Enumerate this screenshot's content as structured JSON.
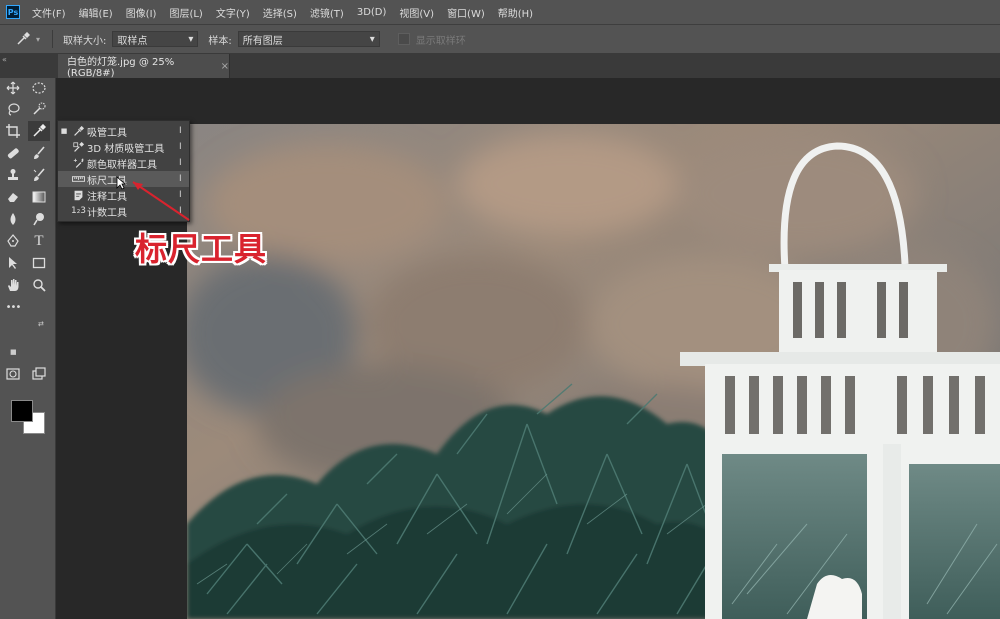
{
  "app": {
    "logo_text": "Ps"
  },
  "menubar": {
    "items": [
      "文件(F)",
      "编辑(E)",
      "图像(I)",
      "图层(L)",
      "文字(Y)",
      "选择(S)",
      "滤镜(T)",
      "3D(D)",
      "视图(V)",
      "窗口(W)",
      "帮助(H)"
    ]
  },
  "options": {
    "tool_icon": "eyedropper-icon",
    "sample_size_label": "取样大小:",
    "sample_size_value": "取样点",
    "sample_label": "样本:",
    "sample_value": "所有图层",
    "show_ring_label": "显示取样环"
  },
  "document": {
    "tab_title": "白色的灯笼.jpg @ 25%(RGB/8#)",
    "close_glyph": "×",
    "panel_collapse": "«"
  },
  "toolbar": {
    "tools": [
      "move-icon",
      "marquee-icon",
      "lasso-icon",
      "quick-select-icon",
      "crop-icon",
      "eyedropper-icon",
      "healing-icon",
      "brush-icon",
      "stamp-icon",
      "history-brush-icon",
      "eraser-icon",
      "gradient-icon",
      "blur-icon",
      "dodge-icon",
      "pen-icon",
      "type-icon",
      "path-select-icon",
      "rectangle-icon",
      "hand-icon",
      "zoom-icon",
      "more-icon",
      "quick-mask-icon",
      "screen-mode-icon"
    ],
    "type_glyph": "T",
    "more_glyph": "•••",
    "foreground_color": "#000000",
    "background_color": "#ffffff"
  },
  "flyout": {
    "items": [
      {
        "label": "吸管工具",
        "icon": "eyedropper-icon",
        "key": "I",
        "current": true
      },
      {
        "label": "3D 材质吸管工具",
        "icon": "3d-eyedropper-icon",
        "key": "I",
        "current": false
      },
      {
        "label": "颜色取样器工具",
        "icon": "color-sampler-icon",
        "key": "I",
        "current": false
      },
      {
        "label": "标尺工具",
        "icon": "ruler-icon",
        "key": "I",
        "current": false,
        "hovered": true
      },
      {
        "label": "注释工具",
        "icon": "note-icon",
        "key": "I",
        "current": false
      },
      {
        "label": "计数工具",
        "icon": "count-icon",
        "key": "I",
        "current": false
      }
    ],
    "count_glyph": "1₂3",
    "bullet": "■"
  },
  "annotation": {
    "text": "标尺工具",
    "color": "#d9232e"
  },
  "colors": {
    "chrome": "#535353",
    "tabbar": "#3a3a3a",
    "workspace": "#282828",
    "flyout": "#424242"
  }
}
